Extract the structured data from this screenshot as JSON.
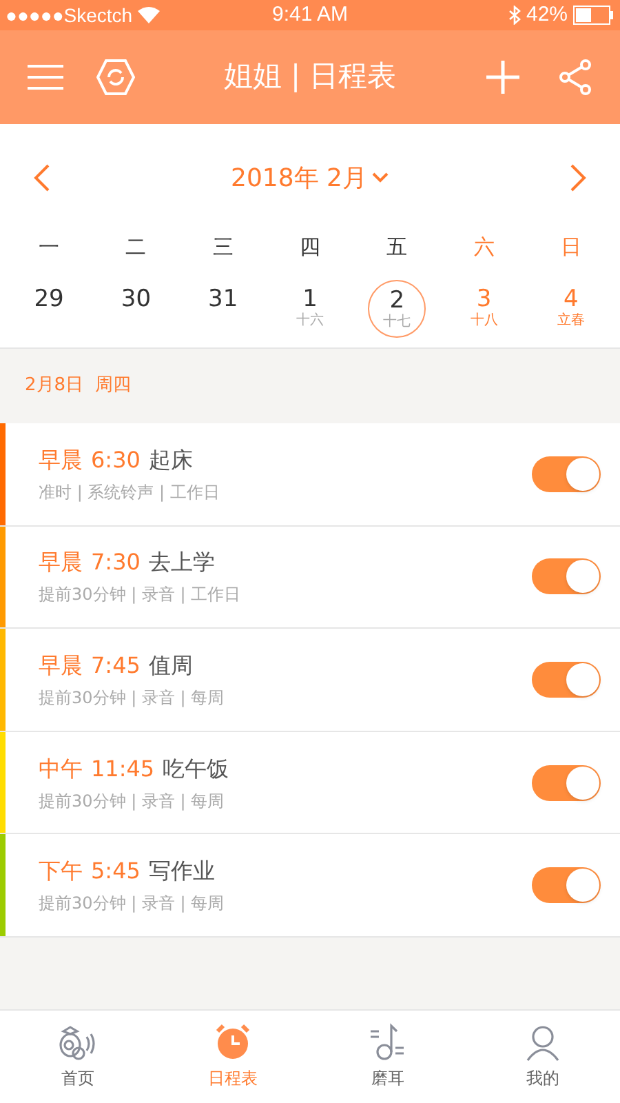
{
  "status_bar": {
    "carrier": "●●●●●Skectch",
    "time": "9:41 AM",
    "battery": "42%"
  },
  "nav": {
    "title": "姐姐 | 日程表"
  },
  "calendar": {
    "month": "2018年 2月",
    "weekdays": [
      {
        "label": "一",
        "weekend": false
      },
      {
        "label": "二",
        "weekend": false
      },
      {
        "label": "三",
        "weekend": false
      },
      {
        "label": "四",
        "weekend": false
      },
      {
        "label": "五",
        "weekend": false
      },
      {
        "label": "六",
        "weekend": true
      },
      {
        "label": "日",
        "weekend": true
      }
    ],
    "days": [
      {
        "day": "29",
        "weekend": false,
        "selected": false
      },
      {
        "day": "30",
        "weekend": false,
        "selected": false
      },
      {
        "day": "31",
        "weekend": false,
        "selected": false
      },
      {
        "day": "1",
        "lunar": "十六",
        "weekend": false,
        "selected": false
      },
      {
        "day": "2",
        "lunar": "十七",
        "weekend": false,
        "selected": true
      },
      {
        "day": "3",
        "lunar": "十八",
        "weekend": true,
        "selected": false
      },
      {
        "day": "4",
        "lunar": "立春",
        "weekend": true,
        "selected": false
      }
    ]
  },
  "date_header": "2月8日  周四",
  "alarms": [
    {
      "period": "早晨",
      "time": "6:30",
      "title": "起床",
      "detail": "准时 | 系统铃声 | 工作日",
      "color": "#ff6a00",
      "on": true
    },
    {
      "period": "早晨",
      "time": "7:30",
      "title": "去上学",
      "detail": "提前30分钟 | 录音 | 工作日",
      "color": "#ff9a00",
      "on": true
    },
    {
      "period": "早晨",
      "time": "7:45",
      "title": "值周",
      "detail": "提前30分钟 | 录音 | 每周",
      "color": "#ffb800",
      "on": true
    },
    {
      "period": "中午",
      "time": "11:45",
      "title": "吃午饭",
      "detail": "提前30分钟 | 录音 | 每周",
      "color": "#ffdd00",
      "on": true
    },
    {
      "period": "下午",
      "time": "5:45",
      "title": "写作业",
      "detail": "提前30分钟 | 录音 | 每周",
      "color": "#9ccc00",
      "on": true
    }
  ],
  "tabs": [
    {
      "label": "首页",
      "kind": "home",
      "selected": false
    },
    {
      "label": "日程表",
      "kind": "alarm",
      "selected": true
    },
    {
      "label": "磨耳",
      "kind": "music",
      "selected": false
    },
    {
      "label": "我的",
      "kind": "user",
      "selected": false
    }
  ]
}
